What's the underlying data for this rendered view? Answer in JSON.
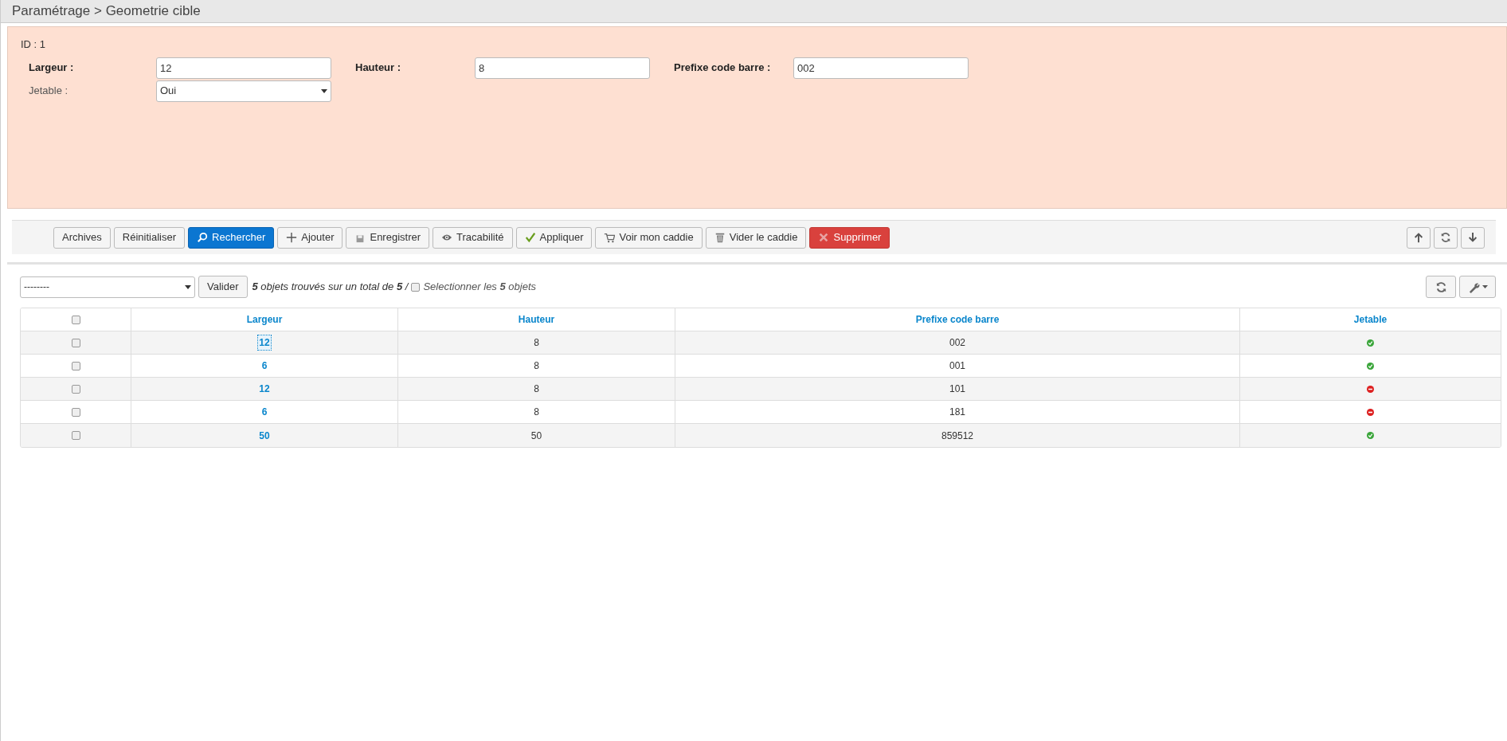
{
  "header": {
    "title": "Paramétrage > Geometrie cible"
  },
  "form": {
    "id_label": "ID : 1",
    "fields": [
      {
        "kind": "input",
        "label": "Largeur :",
        "value": "12",
        "bold": true
      },
      {
        "kind": "input",
        "label": "Hauteur :",
        "value": "8",
        "bold": true
      },
      {
        "kind": "input",
        "label": "Prefixe code barre :",
        "value": "002",
        "bold": true
      },
      {
        "kind": "select",
        "label": "Jetable :",
        "value": "Oui",
        "bold": false
      }
    ]
  },
  "toolbar": {
    "buttons": [
      {
        "kind": "plain",
        "label": "Archives"
      },
      {
        "kind": "plain",
        "label": "Réinitialiser"
      },
      {
        "kind": "search",
        "label": "Rechercher"
      },
      {
        "kind": "add",
        "label": "Ajouter"
      },
      {
        "kind": "save",
        "label": "Enregistrer"
      },
      {
        "kind": "view",
        "label": "Tracabilité"
      },
      {
        "kind": "apply",
        "label": "Appliquer"
      },
      {
        "kind": "cart",
        "label": "Voir mon caddie"
      },
      {
        "kind": "trash",
        "label": "Vider le caddie"
      },
      {
        "kind": "delete",
        "label": "Supprimer"
      }
    ],
    "nav": [
      {
        "kind": "up"
      },
      {
        "kind": "refresh"
      },
      {
        "kind": "down"
      }
    ]
  },
  "list": {
    "action_select": "--------",
    "validate": "Valider",
    "summary": "**5** objets trouvés sur un total de **5** /",
    "select_all": {
      "label": "Selectionner les **5** objets",
      "checked": false
    },
    "columns": [
      "Largeur",
      "Hauteur",
      "Prefixe code barre",
      "Jetable"
    ],
    "header_checked": false,
    "rows": [
      {
        "checked": false,
        "largeur": "12",
        "hauteur": "8",
        "prefixe": "002",
        "jetable": true,
        "focused": true
      },
      {
        "checked": false,
        "largeur": "6",
        "hauteur": "8",
        "prefixe": "001",
        "jetable": true,
        "focused": false
      },
      {
        "checked": false,
        "largeur": "12",
        "hauteur": "8",
        "prefixe": "101",
        "jetable": false,
        "focused": false
      },
      {
        "checked": false,
        "largeur": "6",
        "hauteur": "8",
        "prefixe": "181",
        "jetable": false,
        "focused": false
      },
      {
        "checked": false,
        "largeur": "50",
        "hauteur": "50",
        "prefixe": "859512",
        "jetable": true,
        "focused": false
      }
    ]
  }
}
